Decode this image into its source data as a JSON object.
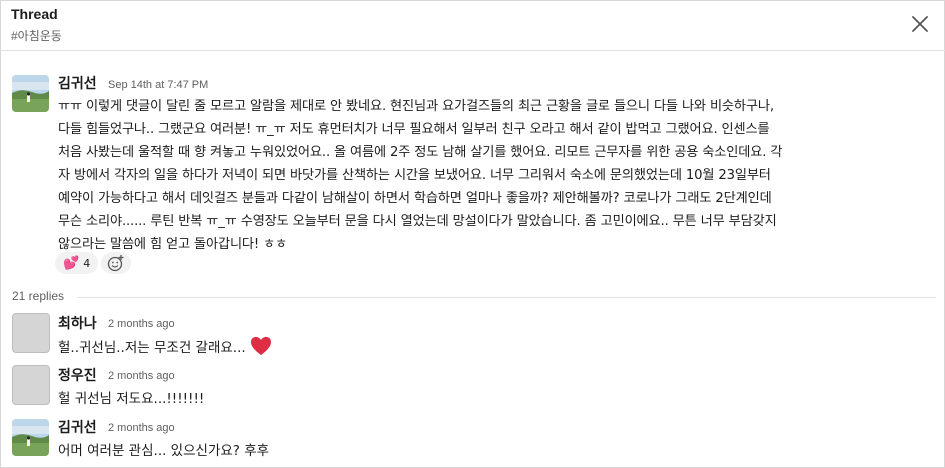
{
  "header": {
    "title": "Thread",
    "channel": "#아침운동",
    "close_icon": "close-icon"
  },
  "parent": {
    "author": "김귀선",
    "timestamp": "Sep 14th at 7:47 PM",
    "lines": [
      "ㅠㅠ 이렇게 댓글이 달린 줄 모르고 알람을 제대로 안 봤네요. 현진님과 요가걸즈들의 최근 근황을 글로 들으니 다들 나와 비슷하구나,",
      "다들 힘들었구나.. 그랬군요 여러분! ㅠ_ㅠ 저도 휴먼터치가 너무 필요해서 일부러 친구 오라고 해서 같이 밥먹고 그랬어요. 인센스를",
      "처음 사봤는데 울적할 때 향 켜놓고 누워있었어요.. 올 여름에 2주 정도 남해 살기를 했어요. 리모트 근무자를 위한 공용 숙소인데요. 각",
      "자 방에서 각자의 일을 하다가 저녁이 되면 바닷가를 산책하는 시간을 보냈어요. 너무 그리워서 숙소에 문의했었는데 10월 23일부터",
      "예약이 가능하다고 해서 데잇걸즈 분들과 다같이 남해살이 하면서 학습하면 얼마나 좋을까? 제안해볼까? 코로나가 그래도 2단계인데",
      "무슨 소리야...... 루틴 반복 ㅠ_ㅠ  수영장도 오늘부터 문을 다시 열었는데 망설이다가 말았습니다. 좀 고민이에요.. 무튼 너무 부담갖지",
      "않으라는 말씀에 힘 얻고 돌아갑니다! ㅎㅎ"
    ],
    "reaction": {
      "emoji": "💕",
      "count": "4"
    },
    "add_reaction_icon": "add-reaction-icon"
  },
  "replies_count": "21 replies",
  "replies": [
    {
      "author": "최하나",
      "timestamp": "2 months ago",
      "text": "헐..귀선님..저는 무조건 갈래요...",
      "emoji": "heart-emoji"
    },
    {
      "author": "정우진",
      "timestamp": "2 months ago",
      "text": "헐 귀선님 저도요...!!!!!!!"
    },
    {
      "author": "김귀선",
      "timestamp": "2 months ago",
      "text": "어머 여러분 관심... 있으신가요? 후후"
    }
  ]
}
